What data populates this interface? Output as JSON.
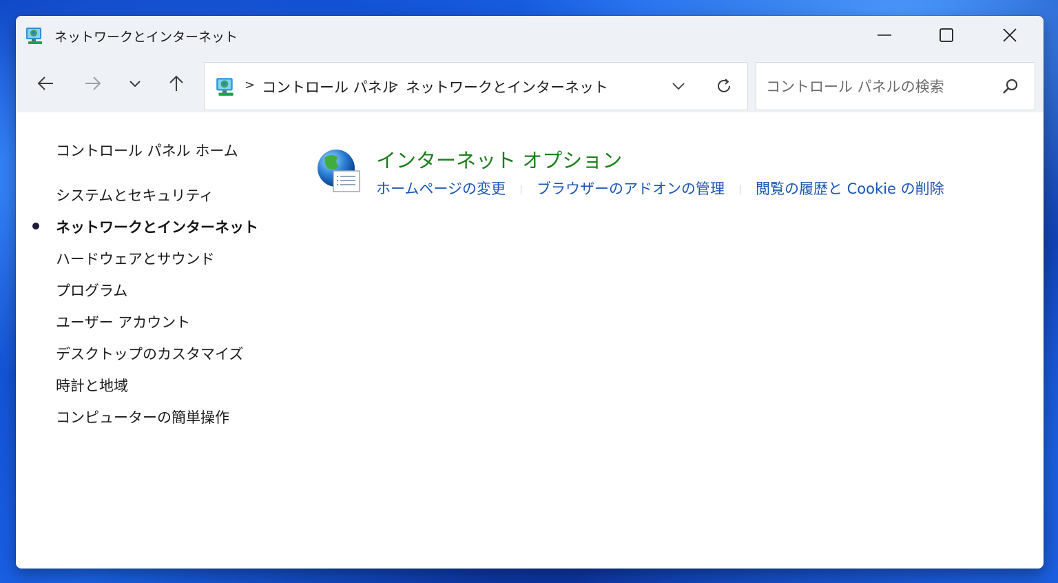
{
  "window": {
    "title": "ネットワークとインターネット",
    "controls": {
      "minimize_icon": "minimize-icon",
      "maximize_icon": "maximize-icon",
      "close_icon": "close-icon"
    }
  },
  "nav": {
    "back_icon": "arrow-left-icon",
    "forward_icon": "arrow-right-icon",
    "recent_icon": "chevron-down-icon",
    "up_icon": "arrow-up-icon"
  },
  "address": {
    "separator": ">",
    "crumbs": [
      "コントロール パネル",
      "ネットワークとインターネット"
    ]
  },
  "search": {
    "placeholder": "コントロール パネルの検索"
  },
  "sidebar": {
    "items": [
      {
        "label": "コントロール パネル ホーム",
        "active": false
      },
      {
        "label": "システムとセキュリティ",
        "active": false
      },
      {
        "label": "ネットワークとインターネット",
        "active": true
      },
      {
        "label": "ハードウェアとサウンド",
        "active": false
      },
      {
        "label": "プログラム",
        "active": false
      },
      {
        "label": "ユーザー アカウント",
        "active": false
      },
      {
        "label": "デスクトップのカスタマイズ",
        "active": false
      },
      {
        "label": "時計と地域",
        "active": false
      },
      {
        "label": "コンピューターの簡単操作",
        "active": false
      }
    ]
  },
  "main": {
    "category": {
      "title": "インターネット オプション",
      "icon": "internet-options-globe-icon",
      "links": [
        "ホームページの変更",
        "ブラウザーのアドオンの管理",
        "閲覧の履歴と Cookie の削除"
      ]
    }
  },
  "colors": {
    "category_title": "#1a7f1a",
    "link": "#1a56b5",
    "titlebar": "#eef1f6"
  }
}
